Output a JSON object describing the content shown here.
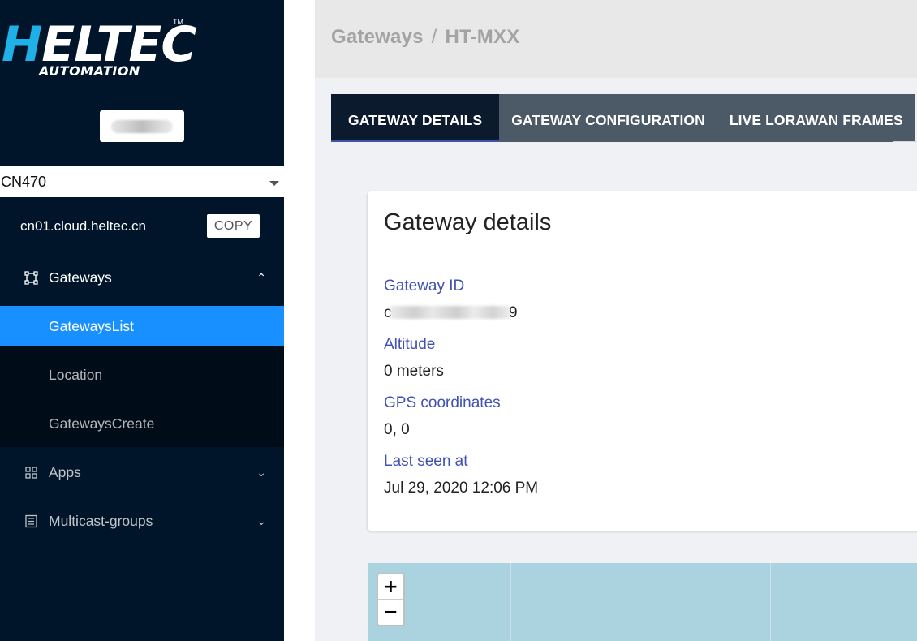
{
  "brand": {
    "logo_main": "HELTEC",
    "logo_sub": "AUTOMATION",
    "trademark": "TM"
  },
  "sidebar": {
    "region": "CN470",
    "server": "cn01.cloud.heltec.cn",
    "copy_label": "COPY",
    "menu": {
      "gateways": {
        "label": "Gateways",
        "icon": "gateway-icon",
        "expanded": true
      },
      "gateways_list": {
        "label": "GatewaysList",
        "active": true
      },
      "location": {
        "label": "Location"
      },
      "gateways_create": {
        "label": "GatewaysCreate"
      },
      "apps": {
        "label": "Apps",
        "icon": "apps-grid-icon"
      },
      "multicast": {
        "label": "Multicast-groups",
        "icon": "multicast-icon"
      }
    }
  },
  "header": {
    "breadcrumb_root": "Gateways",
    "breadcrumb_sep": "/",
    "breadcrumb_current": "HT-MXX"
  },
  "tabs": [
    {
      "label": "GATEWAY DETAILS",
      "active": true
    },
    {
      "label": "GATEWAY CONFIGURATION",
      "active": false
    },
    {
      "label": "LIVE LORAWAN FRAMES",
      "active": false
    }
  ],
  "details": {
    "title": "Gateway details",
    "gateway_id_label": "Gateway ID",
    "gateway_id_start": "c",
    "gateway_id_end": "9",
    "altitude_label": "Altitude",
    "altitude_value": "0 meters",
    "gps_label": "GPS coordinates",
    "gps_value": "0, 0",
    "last_seen_label": "Last seen at",
    "last_seen_value": "Jul 29, 2020 12:06 PM"
  },
  "map": {
    "zoom_in": "+",
    "zoom_out": "−"
  },
  "colors": {
    "sidebar_bg": "#001529",
    "active_item": "#1890ff",
    "label_blue": "#3f51b5",
    "map_water": "#aad3df"
  }
}
